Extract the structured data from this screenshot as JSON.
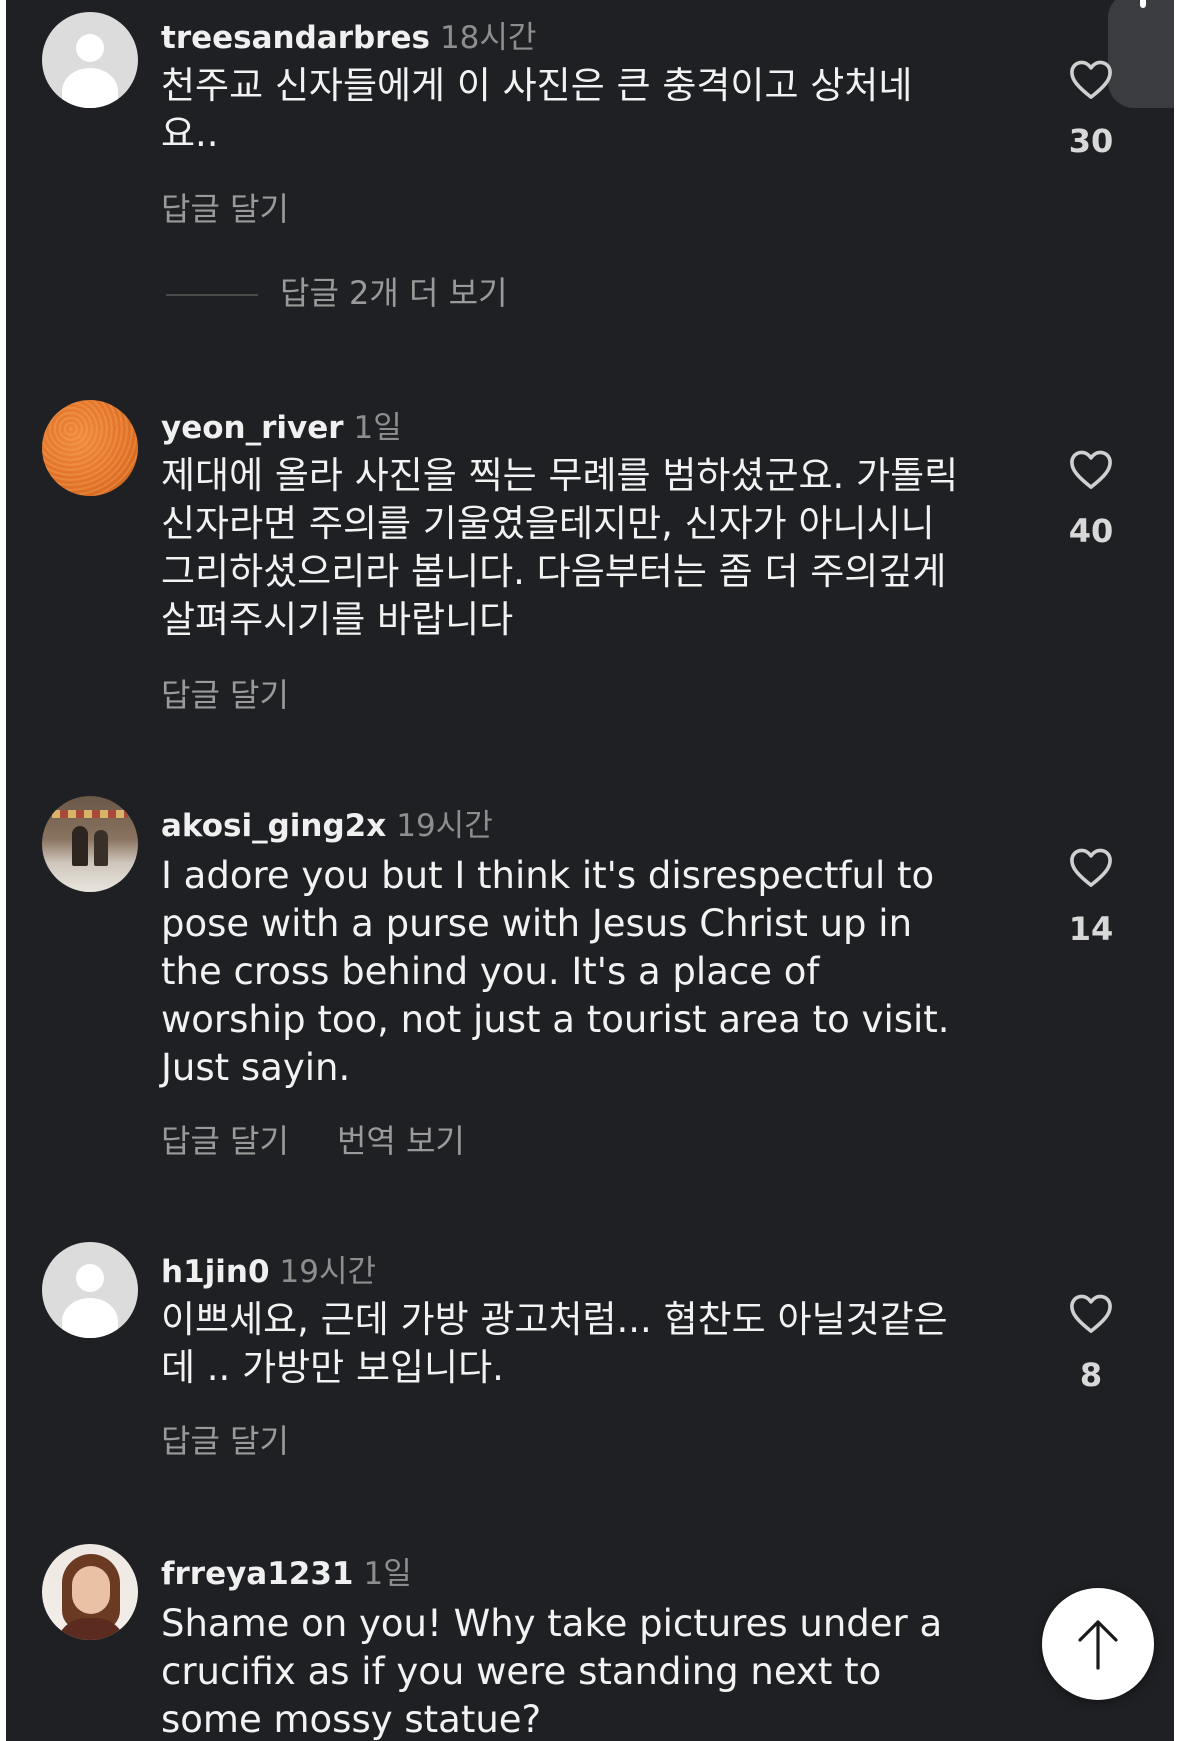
{
  "comments": [
    {
      "username": "treesandarbres",
      "time": "18시간",
      "text": "천주교 신자들에게 이 사진은 큰 충격이고 상처네\n요..",
      "reply_label": "답글 달기",
      "likes": "30",
      "view_replies": "답글 2개 더 보기"
    },
    {
      "username": "yeon_river",
      "time": "1일",
      "text": "제대에 올라 사진을 찍는 무례를 범하셨군요. 가톨릭\n신자라면 주의를 기울였을테지만, 신자가 아니시니\n그리하셨으리라 봅니다. 다음부터는 좀 더 주의깊게\n살펴주시기를 바랍니다",
      "reply_label": "답글 달기",
      "likes": "40"
    },
    {
      "username": "akosi_ging2x",
      "time": "19시간",
      "text": "I adore you but I think it's disrespectful to\npose with a purse with Jesus Christ up in\nthe cross behind you. It's a place of\nworship too, not just a tourist area to visit.\nJust sayin.",
      "reply_label": "답글 달기",
      "translate_label": "번역 보기",
      "likes": "14"
    },
    {
      "username": "h1jin0",
      "time": "19시간",
      "text": "이쁘세요, 근데 가방 광고처럼... 협찬도 아닐것같은\n데 .. 가방만 보입니다.",
      "reply_label": "답글 달기",
      "likes": "8"
    },
    {
      "username": "frreya1231",
      "time": "1일",
      "text": "Shame on you! Why take pictures under a\ncrucifix as if you were standing next to\nsome mossy statue?"
    }
  ],
  "icons": {
    "like": "heart-outline-icon",
    "scroll_top": "arrow-up-icon"
  },
  "colors": {
    "background": "#1f2023",
    "username": "#f0f0f0",
    "secondary": "#9a9a9a"
  }
}
